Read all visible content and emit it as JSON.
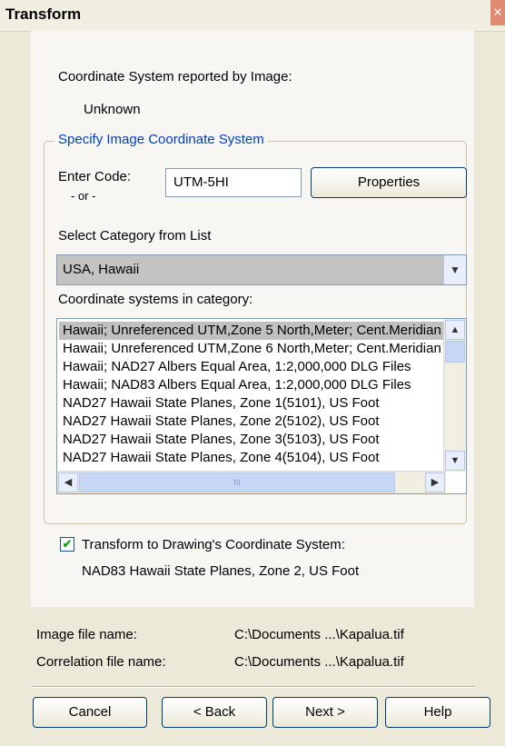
{
  "window": {
    "title": "Transform",
    "close_glyph": "✕"
  },
  "reported": {
    "label": "Coordinate System reported by Image:",
    "value": "Unknown"
  },
  "group": {
    "legend": "Specify Image Coordinate System",
    "enter_code_label": "Enter Code:",
    "or_label": "- or -",
    "code_value": "UTM-5HI",
    "properties_button": "Properties",
    "category_label": "Select Category from List",
    "category_value": "USA, Hawaii",
    "list_label": "Coordinate systems in category:",
    "list_items": [
      "Hawaii; Unreferenced UTM,Zone 5 North,Meter; Cent.Meridian",
      "Hawaii; Unreferenced UTM,Zone 6 North,Meter; Cent.Meridian",
      "Hawaii; NAD27 Albers Equal Area, 1:2,000,000 DLG Files",
      "Hawaii; NAD83 Albers Equal Area, 1:2,000,000 DLG Files",
      "NAD27 Hawaii State Planes, Zone 1(5101), US Foot",
      "NAD27 Hawaii State Planes, Zone 2(5102), US Foot",
      "NAD27 Hawaii State Planes, Zone 3(5103), US Foot",
      "NAD27 Hawaii State Planes, Zone 4(5104), US Foot"
    ],
    "selected_index": 0,
    "hscroll_grip": "III"
  },
  "transform": {
    "checked": true,
    "check_glyph": "✔",
    "label": "Transform to Drawing's Coordinate System:",
    "value": "NAD83 Hawaii State Planes, Zone 2, US Foot"
  },
  "files": {
    "image_label": "Image file name:",
    "image_value": "C:\\Documents ...\\Kapalua.tif",
    "correlation_label": "Correlation file name:",
    "correlation_value": "C:\\Documents ...\\Kapalua.tif"
  },
  "buttons": {
    "cancel": "Cancel",
    "back": "< Back",
    "next": "Next >",
    "help": "Help"
  }
}
